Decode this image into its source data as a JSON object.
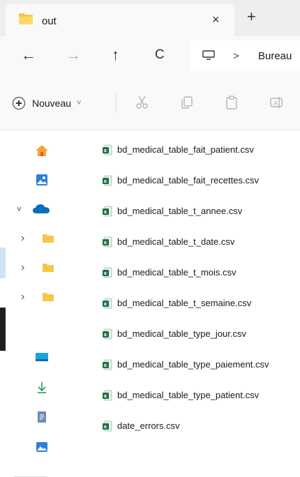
{
  "window": {
    "tab_title": "out",
    "tab_close": "×",
    "new_tab": "+"
  },
  "nav": {
    "back": "←",
    "forward": "→",
    "up": "↑",
    "refresh": "C",
    "breadcrumb_separator": ">",
    "breadcrumb": "Bureau"
  },
  "commands": {
    "new_label": "Nouveau",
    "new_chevron": "˅"
  },
  "files": [
    {
      "name": "bd_medical_table_fait_patient.csv"
    },
    {
      "name": "bd_medical_table_fait_recettes.csv"
    },
    {
      "name": "bd_medical_table_t_annee.csv"
    },
    {
      "name": "bd_medical_table_t_date.csv"
    },
    {
      "name": "bd_medical_table_t_mois.csv"
    },
    {
      "name": "bd_medical_table_t_semaine.csv"
    },
    {
      "name": "bd_medical_table_type_jour.csv"
    },
    {
      "name": "bd_medical_table_type_paiement.csv"
    },
    {
      "name": "bd_medical_table_type_patient.csv"
    },
    {
      "name": "date_errors.csv"
    }
  ],
  "icons": {
    "folder": "folder-icon",
    "file": "excel-csv-icon",
    "home": "home-icon",
    "gallery": "gallery-icon",
    "cloud": "onedrive-cloud-icon",
    "desktop": "desktop-icon",
    "downloads": "downloads-icon",
    "documents": "documents-icon",
    "pictures": "pictures-icon"
  },
  "colors": {
    "accent": "#0067c0",
    "folder_yellow": "#f6c64a",
    "excel_green": "#1d7044",
    "cloud_blue": "#0f6cbd"
  }
}
